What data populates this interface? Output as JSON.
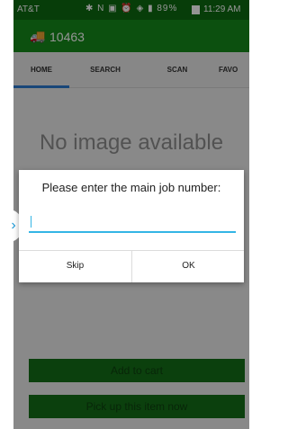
{
  "status_bar": {
    "carrier": "AT&T",
    "icons_text": "✱ N ▣ ⏰ ◈ ▮ 89%",
    "clock": "11:29 AM"
  },
  "app_bar": {
    "job_number": "10463"
  },
  "tabs": [
    {
      "label": "HOME",
      "active": true
    },
    {
      "label": "SEARCH",
      "active": false
    },
    {
      "label": "SCAN",
      "active": false
    },
    {
      "label": "FAVO",
      "active": false
    }
  ],
  "content": {
    "no_image_text": "No image available"
  },
  "dialog": {
    "title": "Please enter the main job number:",
    "input_value": "",
    "skip_label": "Skip",
    "ok_label": "OK"
  },
  "actions": {
    "add_to_cart": "Add to cart",
    "pick_up": "Pick up this item now"
  },
  "colors": {
    "app_bar": "#168a1b",
    "status_bar": "#0d6a10",
    "tab_indicator": "#2c7bd0",
    "input_focus": "#33b5e5"
  }
}
